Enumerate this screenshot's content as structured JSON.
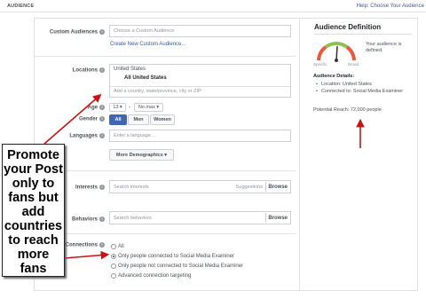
{
  "header": {
    "section_title": "AUDIENCE",
    "help_link": "Help: Choose Your Audience"
  },
  "form": {
    "custom_audiences": {
      "label": "Custom Audiences",
      "placeholder": "Choose a Custom Audience",
      "create_link": "Create New Custom Audience..."
    },
    "locations": {
      "label": "Locations",
      "selected_country": "United States",
      "selected_item": "All United States",
      "placeholder": "Add a country, state/province, city or ZIP"
    },
    "age": {
      "label": "Age",
      "min": "13 ▾",
      "dash": "-",
      "max": "No max ▾"
    },
    "gender": {
      "label": "Gender",
      "options": [
        "All",
        "Men",
        "Women"
      ]
    },
    "languages": {
      "label": "Languages",
      "placeholder": "Enter a language..."
    },
    "more_demographics": "More Demographics ▾",
    "interests": {
      "label": "Interests",
      "placeholder": "Search interests",
      "suggestions": "Suggestions",
      "browse": "Browse"
    },
    "behaviors": {
      "label": "Behaviors",
      "placeholder": "Search behaviors",
      "browse": "Browse"
    },
    "connections": {
      "label": "Connections",
      "options": [
        "All",
        "Only people connected to Social Media Examiner",
        "Only people not connected to Social Media Examiner",
        "Advanced connection targeting"
      ],
      "selected_index": 1
    }
  },
  "callout": {
    "lines": [
      "Promote",
      "your Post",
      "only to",
      "fans but",
      "add",
      "countries",
      "to reach",
      "more",
      "fans"
    ]
  },
  "definition": {
    "title": "Audience Definition",
    "gauge_status": "Your audience is defined.",
    "gauge_left": "Specific",
    "gauge_right": "Broad",
    "details_title": "Audience Details:",
    "details": [
      "Location: United States",
      "Connected to: Social Media Examiner"
    ],
    "potential_reach": "Potential Reach: 72,000 people"
  },
  "colors": {
    "arrow": "#cc1111",
    "link": "#3b5998",
    "active_button": "#4267b2"
  }
}
